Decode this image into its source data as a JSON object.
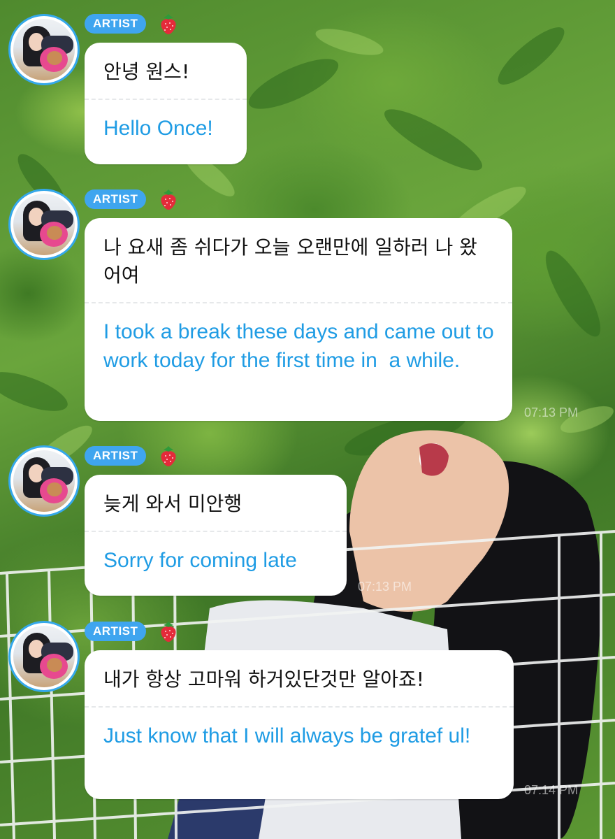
{
  "messages": [
    {
      "badge": "ARTIST",
      "korean": "안녕 원스!",
      "english": "Hello Once!",
      "time": ""
    },
    {
      "badge": "ARTIST",
      "korean": "나 요새 좀 쉬다가 오늘 오랜만에 일하러 나 왔어여",
      "english": "I took a break these days and came out to work today for the first time in  a while.",
      "time": "07:13 PM"
    },
    {
      "badge": "ARTIST",
      "korean": "늦게 와서 미안행",
      "english": "Sorry for coming late",
      "time": "07:13 PM"
    },
    {
      "badge": "ARTIST",
      "korean": "내가 항상 고마워 하거있단것만 알아죠!",
      "english": "Just know that I will always be gratef ul!",
      "time": "07:14 PM"
    }
  ],
  "colors": {
    "badge": "#3fa5ef",
    "translation_text": "#1f9ce4",
    "avatar_ring": "#35a8ea"
  },
  "icons": {
    "badge_decoration": "strawberry-icon"
  }
}
